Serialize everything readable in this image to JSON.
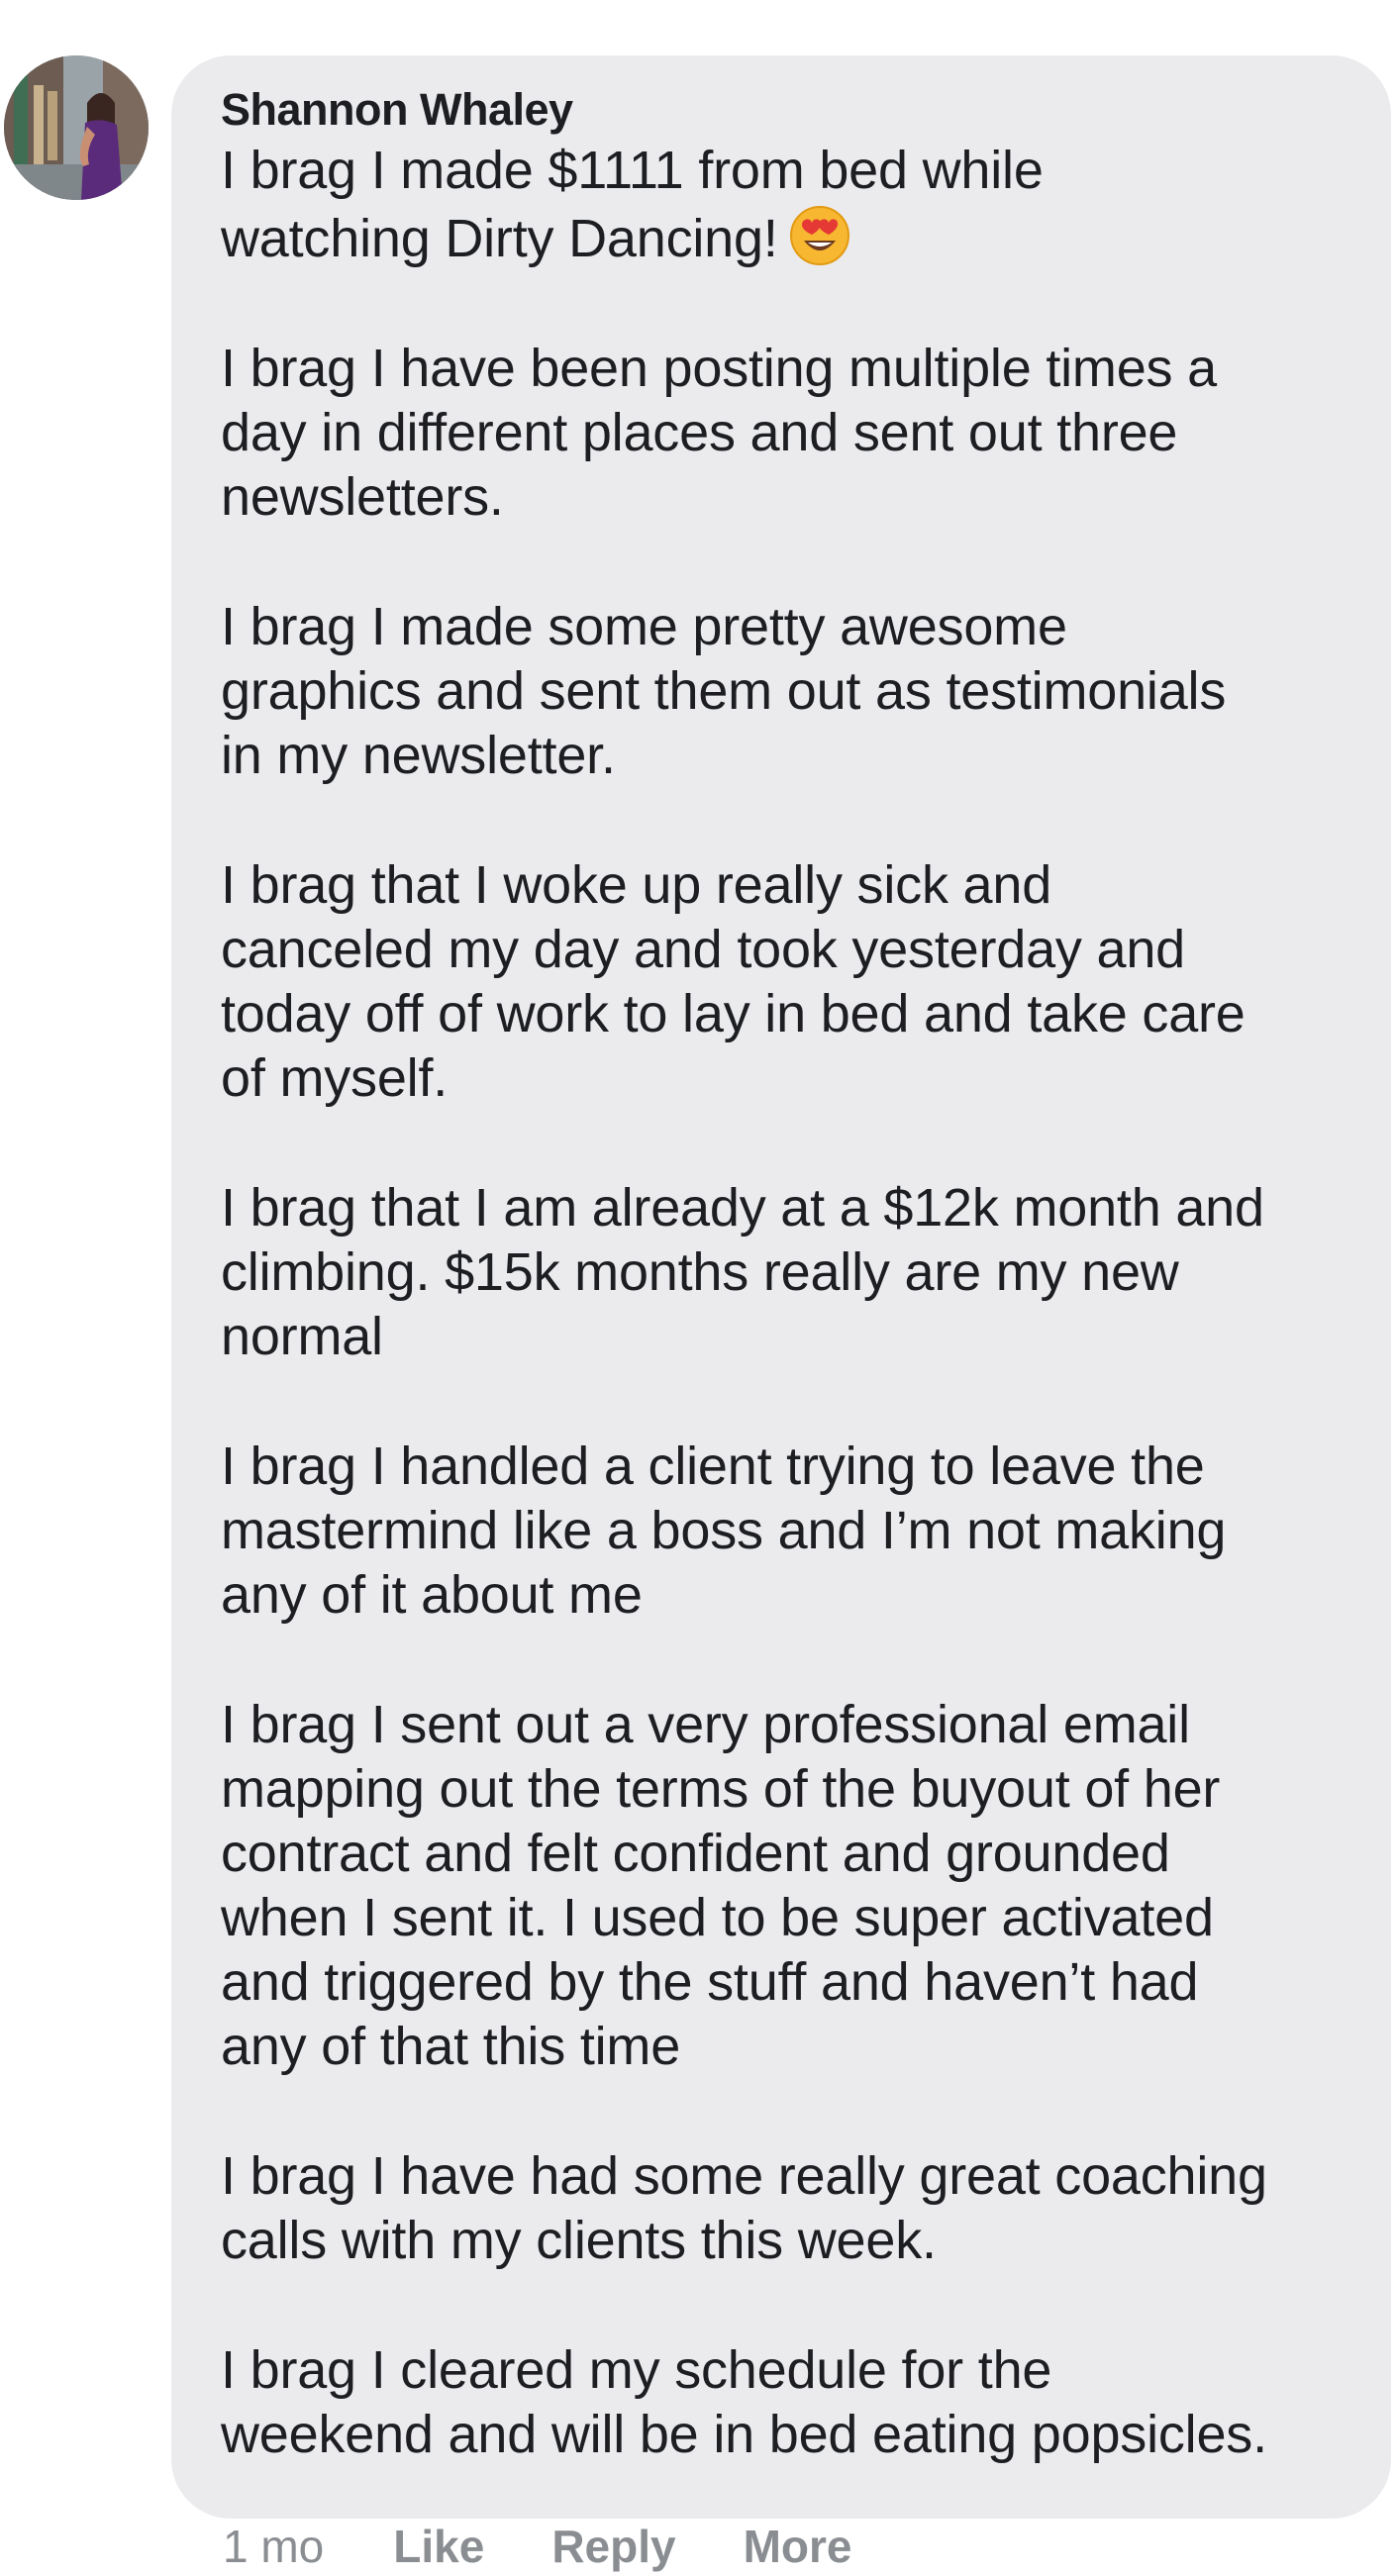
{
  "comment": {
    "author": "Shannon Whaley",
    "paragraphs": [
      {
        "text": "I brag I made $1111 from bed while\nwatching Dirty Dancing!",
        "emoji": "heart-eyes-emoji"
      },
      {
        "text": "I brag I have been posting multiple times a\nday in different places and sent out three\nnewsletters."
      },
      {
        "text": "I brag I made some pretty awesome\ngraphics and sent them out as testimonials\nin my newsletter."
      },
      {
        "text": "I brag that I woke up really sick and\ncanceled my day and took yesterday and\ntoday off of work to lay in bed and take care\nof myself."
      },
      {
        "text": "I brag that I am already at a $12k month and\nclimbing. $15k months really are my new\nnormal"
      },
      {
        "text": "I brag I handled a client trying to leave the\nmastermind like a boss and I’m not making\nany of it about me"
      },
      {
        "text": "I brag I sent out a very professional email\nmapping out the terms of the buyout of her\ncontract and felt confident and grounded\nwhen I sent it. I used to be super activated\nand triggered by the stuff and haven’t had\nany of that this time"
      },
      {
        "text": "I brag I have had some really great coaching\ncalls with my clients this week."
      },
      {
        "text": "I brag I cleared my schedule for the\nweekend and will be in bed eating popsicles."
      }
    ],
    "timestamp": "1 mo",
    "actions": {
      "like": "Like",
      "reply": "Reply",
      "more": "More"
    }
  },
  "colors": {
    "bubble": "#ebebee",
    "text": "#1c1e21",
    "meta": "#8a8d91"
  }
}
